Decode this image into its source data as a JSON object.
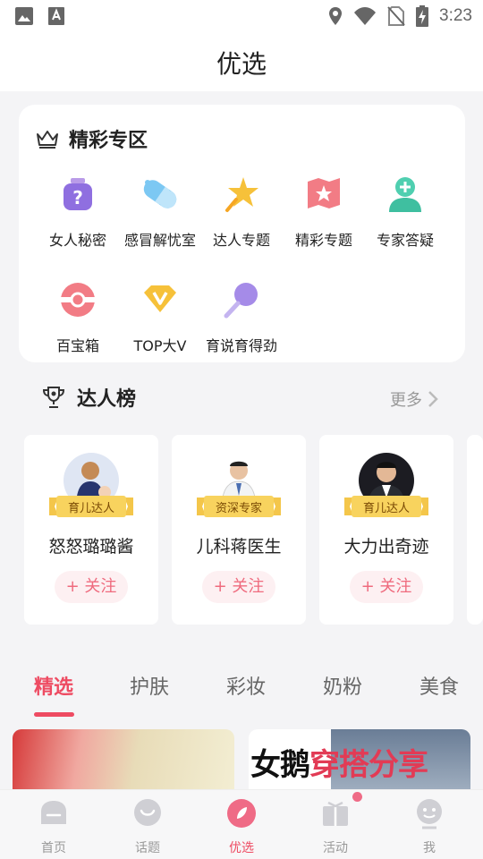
{
  "status_bar": {
    "time": "3:23",
    "left_icons": [
      "image-icon",
      "keyboard-a-icon"
    ],
    "right_icons": [
      "location-icon",
      "wifi-icon",
      "no-sim-icon",
      "battery-charging-icon"
    ]
  },
  "header": {
    "title": "优选"
  },
  "featured": {
    "title": "精彩专区",
    "items": [
      {
        "label": "女人秘密",
        "icon": "secret-bottle-icon"
      },
      {
        "label": "感冒解忧室",
        "icon": "pill-icon"
      },
      {
        "label": "达人专题",
        "icon": "star-wand-icon"
      },
      {
        "label": "精彩专题",
        "icon": "map-star-icon"
      },
      {
        "label": "专家答疑",
        "icon": "doctor-icon"
      },
      {
        "label": "百宝箱",
        "icon": "treasure-box-icon"
      },
      {
        "label": "TOP大V",
        "icon": "top-v-diamond-icon"
      },
      {
        "label": "育说育得劲",
        "icon": "lollipop-icon"
      }
    ]
  },
  "ranking": {
    "title": "达人榜",
    "more": "更多",
    "experts": [
      {
        "name": "怒怒璐璐酱",
        "badge": "育儿达人",
        "follow": "+ 关注"
      },
      {
        "name": "儿科蒋医生",
        "badge": "资深专家",
        "follow": "+ 关注"
      },
      {
        "name": "大力出奇迹",
        "badge": "育儿达人",
        "follow": "+ 关注"
      }
    ]
  },
  "tabs": [
    {
      "label": "精选",
      "active": true
    },
    {
      "label": "护肤",
      "active": false
    },
    {
      "label": "彩妆",
      "active": false
    },
    {
      "label": "奶粉",
      "active": false
    },
    {
      "label": "美食",
      "active": false
    }
  ],
  "feed": {
    "card2_text_a": "女鹅",
    "card2_text_b": "穿搭分享"
  },
  "bottom_nav": [
    {
      "label": "首页",
      "icon": "home-icon"
    },
    {
      "label": "话题",
      "icon": "topic-icon"
    },
    {
      "label": "优选",
      "icon": "featured-icon",
      "active": true
    },
    {
      "label": "活动",
      "icon": "gift-icon"
    },
    {
      "label": "我",
      "icon": "profile-icon"
    }
  ],
  "colors": {
    "accent": "#ee4b62",
    "follow_bg": "#fdf0f2",
    "badge_gold": "#f4c64a"
  }
}
